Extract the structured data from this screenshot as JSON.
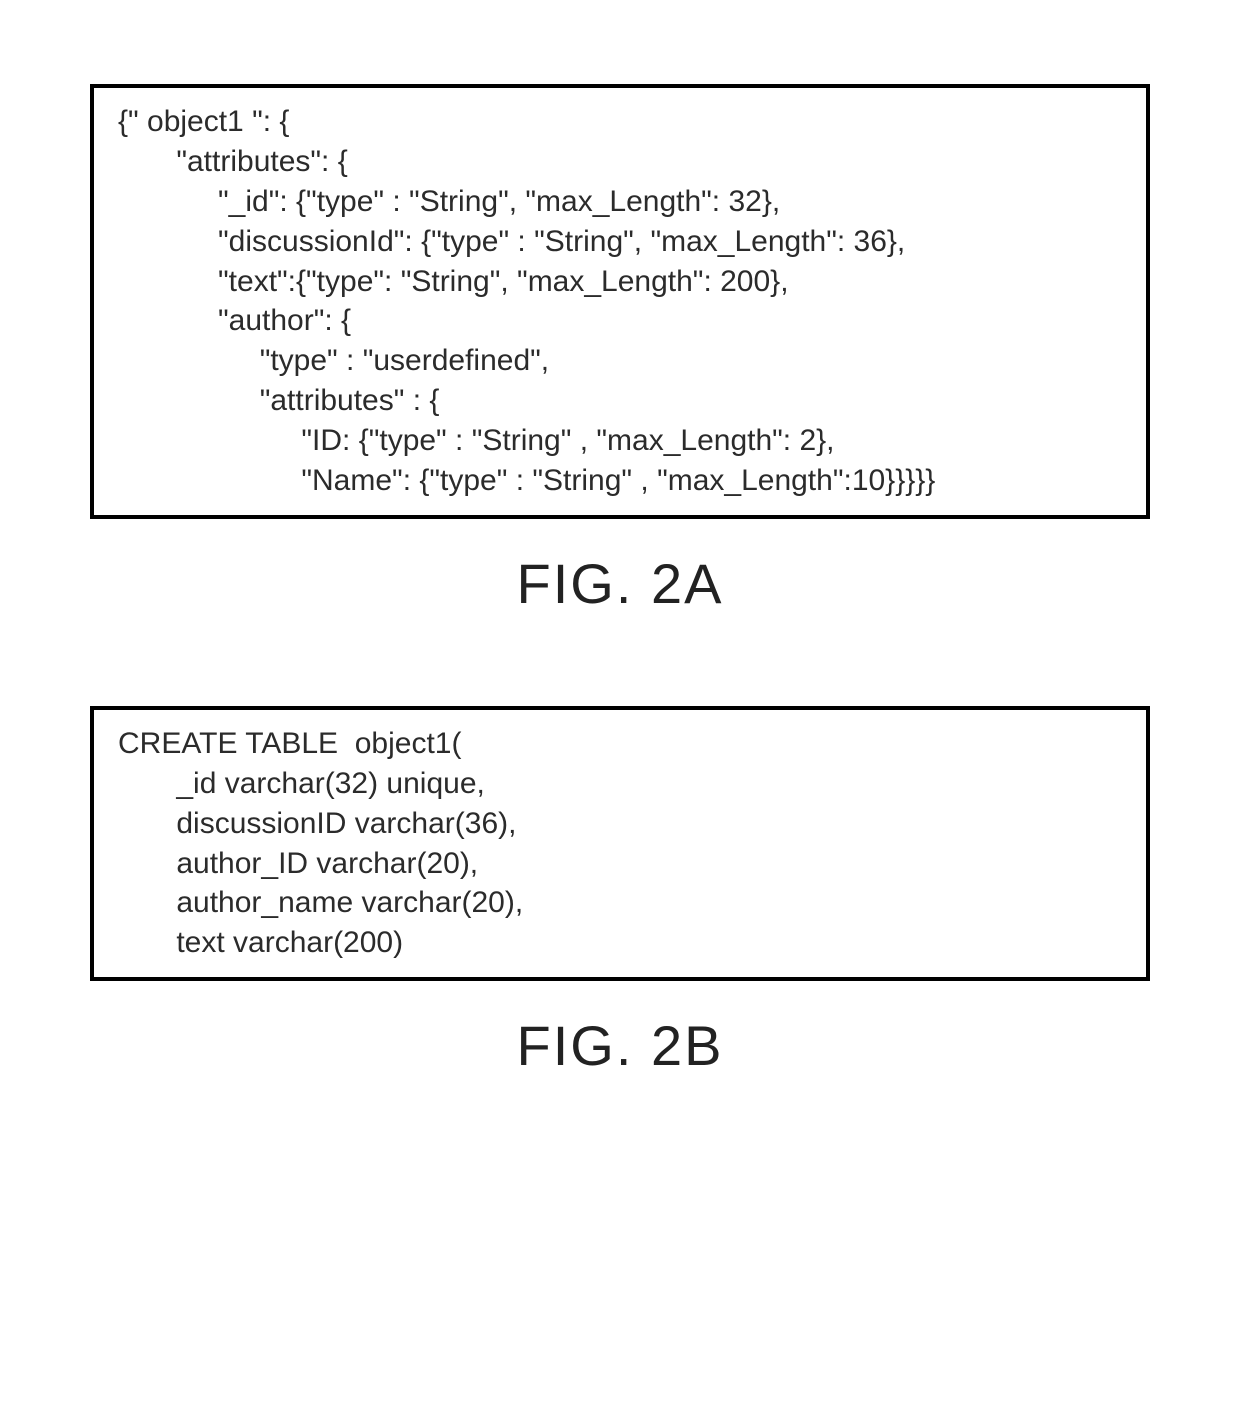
{
  "figA": {
    "caption": "FIG. 2A",
    "lines": [
      "{\" object1 \": {",
      "       \"attributes\": {",
      "            \"_id\": {\"type\" : \"String\", \"max_Length\": 32},",
      "            \"discussionId\": {\"type\" : \"String\", \"max_Length\": 36},",
      "            \"text\":{\"type\": \"String\", \"max_Length\": 200},",
      "            \"author\": {",
      "                 \"type\" : \"userdefined\",",
      "                 \"attributes\" : {",
      "                      \"ID: {\"type\" : \"String\" , \"max_Length\": 2},",
      "                      \"Name\": {\"type\" : \"String\" , \"max_Length\":10}}}}}"
    ]
  },
  "figB": {
    "caption": "FIG. 2B",
    "lines": [
      "CREATE TABLE  object1(",
      "       _id varchar(32) unique,",
      "       discussionID varchar(36),",
      "       author_ID varchar(20),",
      "       author_name varchar(20),",
      "       text varchar(200)"
    ]
  }
}
